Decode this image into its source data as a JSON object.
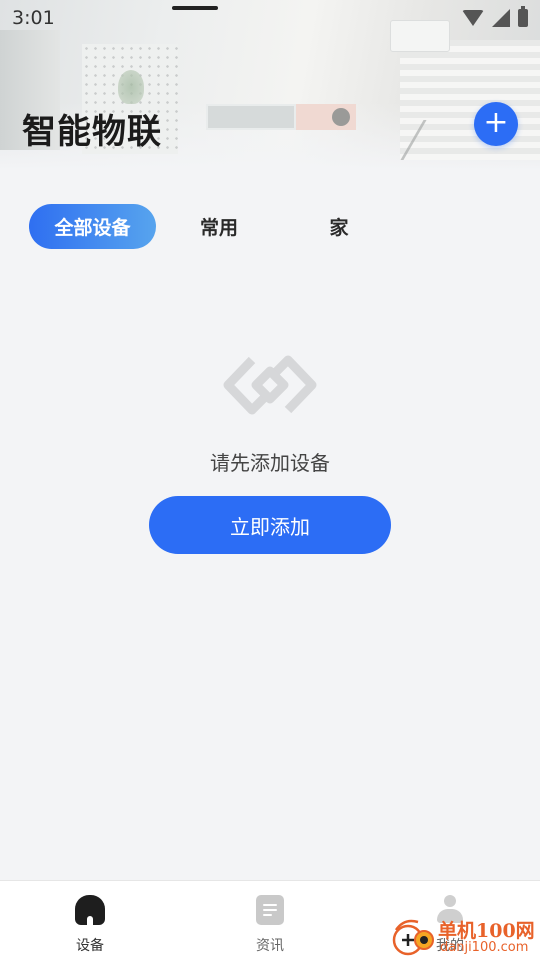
{
  "status_bar": {
    "time": "3:01"
  },
  "header": {
    "title": "智能物联",
    "add_button_icon": "plus-icon",
    "add_button_symbol": "+"
  },
  "tabs": [
    {
      "label": "全部设备",
      "active": true
    },
    {
      "label": "常用",
      "active": false
    },
    {
      "label": "家",
      "active": false
    }
  ],
  "empty_state": {
    "icon": "device-link-icon",
    "message": "请先添加设备",
    "button_label": "立即添加"
  },
  "bottom_nav": [
    {
      "label": "设备",
      "icon": "home-icon",
      "active": true
    },
    {
      "label": "资讯",
      "icon": "news-icon",
      "active": false
    },
    {
      "label": "我的",
      "icon": "person-icon",
      "active": false
    }
  ],
  "watermark": {
    "cn": "单机100网",
    "en": "danji100.com"
  },
  "colors": {
    "accent": "#2c6df5",
    "tab_gradient_start": "#2f6ff1",
    "tab_gradient_end": "#57a4ee",
    "background": "#f3f4f6",
    "watermark": "#e8622a"
  }
}
